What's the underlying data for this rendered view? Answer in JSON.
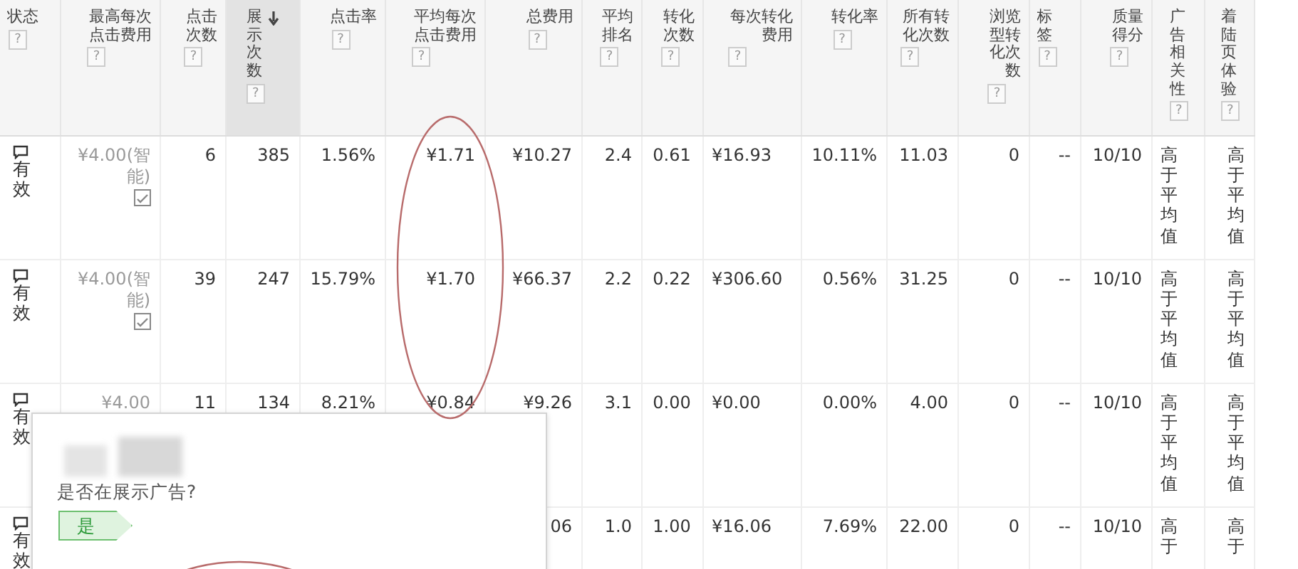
{
  "table": {
    "columns": [
      {
        "label": "状态",
        "help": "?",
        "sorted": false
      },
      {
        "label": "最高每次点击费用",
        "help": "?",
        "sorted": false
      },
      {
        "label": "点击次数",
        "help": "?",
        "sorted": false
      },
      {
        "label": "展示次数",
        "help": "?",
        "sorted": true
      },
      {
        "label": "点击率",
        "help": "?",
        "sorted": false
      },
      {
        "label": "平均每次点击费用",
        "help": "?",
        "sorted": false
      },
      {
        "label": "总费用",
        "help": "?",
        "sorted": false
      },
      {
        "label": "平均排名",
        "help": "?",
        "sorted": false
      },
      {
        "label": "转化次数",
        "help": "?",
        "sorted": false
      },
      {
        "label": "每次转化费用",
        "help": "?",
        "sorted": false
      },
      {
        "label": "转化率",
        "help": "?",
        "sorted": false
      },
      {
        "label": "所有转化次数",
        "help": "?",
        "sorted": false
      },
      {
        "label": "浏览型转化次数",
        "help": "?",
        "sorted": false
      },
      {
        "label": "标签",
        "help": "?",
        "sorted": false
      },
      {
        "label": "质量得分",
        "help": "?",
        "sorted": false
      },
      {
        "label": "广告相关性",
        "help": "?",
        "sorted": false
      },
      {
        "label": "着陆页体验",
        "help": "?",
        "sorted": false
      }
    ],
    "rows": [
      {
        "bid_strategy": "(智能)",
        "cells": [
          "有效",
          "¥4.00",
          "6",
          "385",
          "1.56%",
          "¥1.71",
          "¥10.27",
          "2.4",
          "0.61",
          "¥16.93",
          "10.11%",
          "11.03",
          "0",
          "--",
          "10/10",
          "高于平均值",
          "高于平均值"
        ]
      },
      {
        "bid_strategy": "(智能)",
        "cells": [
          "有效",
          "¥4.00",
          "39",
          "247",
          "15.79%",
          "¥1.70",
          "¥66.37",
          "2.2",
          "0.22",
          "¥306.60",
          "0.56%",
          "31.25",
          "0",
          "--",
          "10/10",
          "高于平均值",
          "高于平均值"
        ]
      },
      {
        "bid_strategy": null,
        "cells": [
          "有效",
          "¥4.00",
          "11",
          "134",
          "8.21%",
          "¥0.84",
          "¥9.26",
          "3.1",
          "0.00",
          "¥0.00",
          "0.00%",
          "4.00",
          "0",
          "--",
          "10/10",
          "高于平均值",
          "高于平均值"
        ]
      },
      {
        "bid_strategy": null,
        "cells": [
          "有效",
          null,
          null,
          null,
          null,
          null,
          "06",
          "1.0",
          "1.00",
          "¥16.06",
          "7.69%",
          "22.00",
          "0",
          "--",
          "10/10",
          "高于",
          "高于"
        ]
      }
    ]
  },
  "popup": {
    "question": "是否在展示广告?",
    "answer": "是"
  }
}
